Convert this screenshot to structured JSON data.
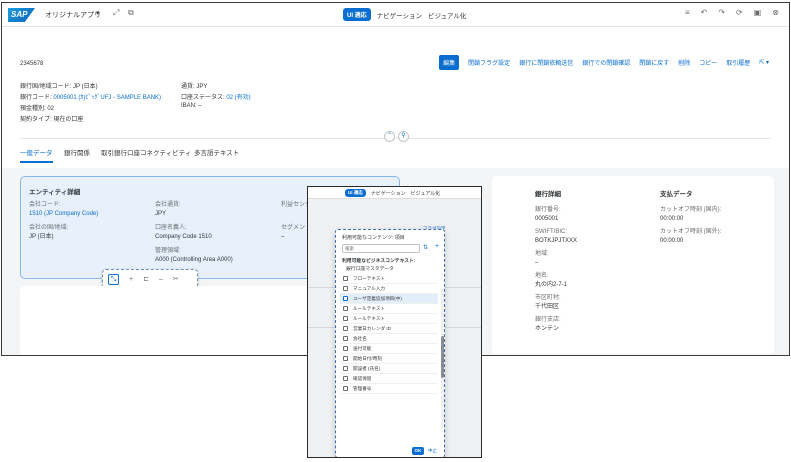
{
  "shell": {
    "logo": "SAP",
    "app_title": "オリジナルアプリ",
    "tabs": [
      {
        "label": "UI 適応",
        "active": true
      },
      {
        "label": "ナビゲーション"
      },
      {
        "label": "ビジュアル化"
      }
    ]
  },
  "header": {
    "object_id": "2345678",
    "actions": [
      "編集",
      "閉鎖フラグ設定",
      "銀行に閉鎖依頼送信",
      "銀行での閉鎖確認",
      "閉鎖に戻す",
      "削除",
      "コピー",
      "取引履歴"
    ],
    "col1": [
      {
        "label": "銀行国/地域コード:",
        "value": "JP (日本)"
      },
      {
        "label": "銀行コード:",
        "value": "0005001 (ｶ)ﾋﾞｯｸﾞUFJ - SAMPLE BANK)"
      },
      {
        "label": "預金種別:",
        "value": "02"
      },
      {
        "label": "契約タイプ:",
        "value": "現在の口座"
      }
    ],
    "col2": [
      {
        "label": "通貨:",
        "value": "JPY"
      },
      {
        "label": "口座ステータス:",
        "value": "02 (有効)"
      },
      {
        "label": "IBAN:",
        "value": "–"
      }
    ]
  },
  "tabs": [
    "一般データ",
    "銀行関係",
    "取引銀行口座コネクティビティ",
    "多言語テキスト"
  ],
  "entity": {
    "title": "エンティティ詳細",
    "fields": [
      {
        "label": "会社コード:",
        "value": "1510 (JP Company Code)"
      },
      {
        "label": "会社の国/地域:",
        "value": "JP (日本)"
      },
      {
        "label": "会社通貨:",
        "value": "JPY"
      },
      {
        "label": "口座名義人:",
        "value": "Company Code 1510"
      },
      {
        "label": "管理領域:",
        "value": "A000 (Controlling Area A000)"
      },
      {
        "label": "利益センタ",
        "value": ""
      },
      {
        "label": "セグメント",
        "value": "–"
      }
    ]
  },
  "bank": {
    "title": "銀行詳細",
    "fields": [
      {
        "label": "銀行番号:",
        "value": "0005001"
      },
      {
        "label": "SWIFT/BIC:",
        "value": "BOTKJPJTXXX"
      },
      {
        "label": "地域:",
        "value": "–"
      },
      {
        "label": "地名:",
        "value": "丸の内2-7-1"
      },
      {
        "label": "市区町村:",
        "value": "千代田区"
      },
      {
        "label": "銀行支店:",
        "value": "ホンテン"
      }
    ]
  },
  "payment": {
    "title": "支払データ",
    "fields": [
      {
        "label": "カットオフ時刻 (国内):",
        "value": "00:00:00"
      },
      {
        "label": "カットオフ時刻 (国外):",
        "value": "00:00:00"
      }
    ]
  },
  "popup": {
    "tabs": [
      {
        "label": "UI 適応",
        "active": true
      },
      {
        "label": "ナビゲーション"
      },
      {
        "label": "ビジュアル化"
      }
    ],
    "bg_link": "フラグ設定",
    "title": "利用可能なコンテンツ: 項目",
    "search_placeholder": "検索",
    "group_header": "利用可能なビジネスコンテキスト:",
    "group_sub": "銀行口座マスタデータ",
    "items": [
      "フローテキスト",
      "マニュアル入力",
      "ユーザ定義追加項目(中)",
      "ルールテキスト",
      "ルールテキスト",
      "営業日カレンダ ID",
      "会社名",
      "送付可能",
      "開始日付/時刻",
      "開設者 (氏名)",
      "確認保留",
      "管理番号"
    ],
    "active_index": 2,
    "ok_label": "OK",
    "cancel_label": "中止"
  }
}
